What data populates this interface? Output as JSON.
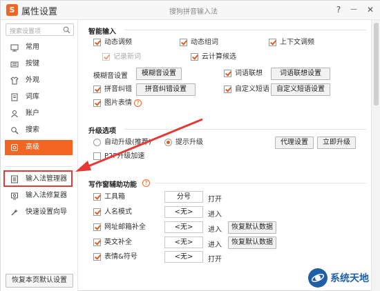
{
  "window": {
    "logo_glyph": "S",
    "title": "属性设置",
    "subtitle": "搜狗拼音输入法",
    "help_btn": "?",
    "minimize_btn": "—",
    "close_btn": "✕"
  },
  "sidebar": {
    "search_placeholder": "搜索设置项",
    "items": [
      {
        "label": "常用",
        "icon": "monitor-icon"
      },
      {
        "label": "按键",
        "icon": "keyboard-icon"
      },
      {
        "label": "外观",
        "icon": "shirt-icon"
      },
      {
        "label": "词库",
        "icon": "book-icon"
      },
      {
        "label": "账户",
        "icon": "user-icon"
      },
      {
        "label": "搜索",
        "icon": "search-icon"
      },
      {
        "label": "高级",
        "icon": "gear-icon",
        "active": true
      }
    ],
    "tools": [
      {
        "label": "输入法管理器",
        "icon": "list-icon"
      },
      {
        "label": "输入法修复器",
        "icon": "repair-icon"
      },
      {
        "label": "快速设置向导",
        "icon": "wizard-icon"
      }
    ],
    "reset_button": "恢复本页默认设置"
  },
  "smart_input": {
    "title": "智能输入",
    "dynamic_freq": "动态调频",
    "dynamic_phrase": "动态组词",
    "context_freq": "上下文调频",
    "record_new_words": "记录新词",
    "cloud_candidates": "云计算候选",
    "fuzzy_label": "模糊音设置",
    "fuzzy_btn": "模糊音设置",
    "association": "词语联想",
    "association_btn": "词语联想设置",
    "pinyin_correct": "拼音纠错",
    "pinyin_correct_btn": "拼音纠错设置",
    "custom_phrase": "自定义短语",
    "custom_phrase_btn": "自定义短语设置",
    "image_emoji": "图片表情",
    "help": "?"
  },
  "upgrade": {
    "title": "升级选项",
    "auto": "自动升级(推荐)",
    "prompt": "提示升级",
    "proxy_btn": "代理设置",
    "upgrade_now_btn": "立即升级",
    "p2p": "P2P升级加速"
  },
  "writing": {
    "title": "写作窗辅助功能",
    "help": "?",
    "rows": [
      {
        "label": "工具箱",
        "value": "分号",
        "suffix": "打开",
        "restore": ""
      },
      {
        "label": "人名模式",
        "value": "<无>",
        "suffix": "进入",
        "restore": ""
      },
      {
        "label": "网址邮箱补全",
        "value": "<无>",
        "suffix": "进入",
        "restore": "恢复默认数据"
      },
      {
        "label": "英文补全",
        "value": "<无>",
        "suffix": "进入",
        "restore": "恢复默认数据"
      },
      {
        "label": "表情&符号",
        "value": "<无>",
        "suffix": "打开",
        "restore": ""
      }
    ]
  },
  "watermark": {
    "text": "系统天地"
  },
  "colors": {
    "accent": "#f26522",
    "highlight": "#e53935",
    "watermark": "#1e5fa8"
  }
}
